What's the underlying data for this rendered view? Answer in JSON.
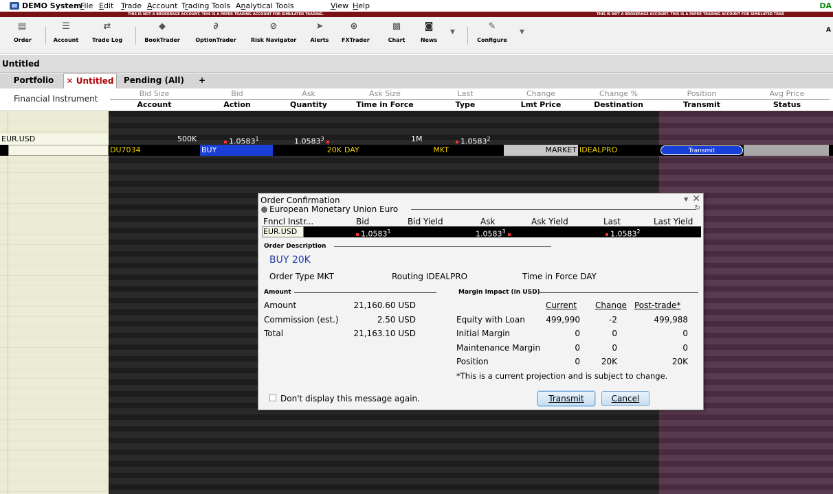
{
  "menubar": {
    "app_title": "DEMO System",
    "items": [
      "File",
      "Edit",
      "Trade",
      "Account",
      "Trading Tools",
      "Analytical Tools",
      "View",
      "Help"
    ],
    "mnemonics": [
      "F",
      "E",
      "T",
      "A",
      "r",
      "n",
      "V",
      "H"
    ],
    "corner": "DA"
  },
  "warning": {
    "center": "THIS IS NOT A BROKERAGE ACCOUNT. THIS IS A PAPER TRADING ACCOUNT FOR SIMULATED TRADING.",
    "right": "THIS IS NOT A BROKERAGE ACCOUNT. THIS IS A PAPER TRADING ACCOUNT FOR SIMULATED TRAD"
  },
  "toolbar": {
    "order": "Order",
    "account": "Account",
    "trade_log": "Trade Log",
    "booktrader": "BookTrader",
    "optiontrader": "OptionTrader",
    "risk_navigator": "Risk Navigator",
    "alerts": "Alerts",
    "fxtrader": "FXTrader",
    "chart": "Chart",
    "news": "News",
    "configure": "Configure",
    "corner": "A"
  },
  "window_title": "Untitled",
  "tabs": {
    "portfolio": "Portfolio",
    "untitled": "Untitled",
    "pending": "Pending (All)",
    "add": "+"
  },
  "columns": {
    "instrument": "Financial Instrument",
    "top": [
      "Bid Size",
      "Bid",
      "Ask",
      "Ask Size",
      "Last",
      "Change",
      "Change %",
      "Position",
      "Avg Price"
    ],
    "bottom": [
      "Account",
      "Action",
      "Quantity",
      "Time in Force",
      "Type",
      "Lmt Price",
      "Destination",
      "Transmit",
      "Status"
    ]
  },
  "quote_row": {
    "symbol": "EUR.USD",
    "bid_size": "500K",
    "bid": "1.0583",
    "bid_sup": "1",
    "ask": "1.0583",
    "ask_sup": "3",
    "ask_size": "1M",
    "last": "1.0583",
    "last_sup": "2"
  },
  "order_row": {
    "account": "DU7034",
    "action": "BUY",
    "quantity": "20K",
    "tif": "DAY",
    "type": "MKT",
    "lmt_price": "MARKET",
    "destination": "IDEALPRO",
    "transmit": "Transmit"
  },
  "dialog": {
    "title": "Order Confirmation",
    "group": "European Monetary Union Euro",
    "hdr": {
      "instr": "Fnncl Instr...",
      "bid": "Bid",
      "bid_yield": "Bid Yield",
      "ask": "Ask",
      "ask_yield": "Ask Yield",
      "last": "Last",
      "last_yield": "Last Yield"
    },
    "row": {
      "symbol": "EUR.USD",
      "bid": "1.0583",
      "bid_sup": "1",
      "ask": "1.0583",
      "ask_sup": "3",
      "last": "1.0583",
      "last_sup": "2"
    },
    "order_description_label": "Order Description",
    "description": "BUY 20K",
    "order_type": "Order Type MKT",
    "routing": "Routing IDEALPRO",
    "tif": "Time in Force DAY",
    "amount_section": "Amount",
    "amount": {
      "amount_label": "Amount",
      "amount_value": "21,160.60 USD",
      "commission_label": "Commission (est.)",
      "commission_value": "2.50 USD",
      "total_label": "Total",
      "total_value": "21,163.10 USD"
    },
    "margin_section": "Margin Impact (in USD)",
    "margin_headers": {
      "current": "Current",
      "change": "Change",
      "post": "Post-trade*"
    },
    "margin_rows": [
      {
        "label": "Equity with Loan",
        "current": "499,990",
        "change": "-2",
        "post": "499,988"
      },
      {
        "label": "Initial Margin",
        "current": "0",
        "change": "0",
        "post": "0"
      },
      {
        "label": "Maintenance Margin",
        "current": "0",
        "change": "0",
        "post": "0"
      },
      {
        "label": "Position",
        "current": "0",
        "change": "20K",
        "post": "20K"
      }
    ],
    "footnote": "*This is a current projection and is subject to change.",
    "dont_display": "Don't display this message again.",
    "transmit": "Transmit",
    "cancel": "Cancel"
  }
}
